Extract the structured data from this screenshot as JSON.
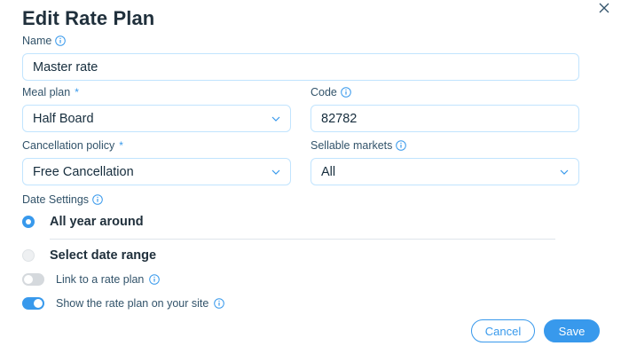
{
  "dialog": {
    "title": "Edit Rate Plan"
  },
  "name": {
    "label": "Name",
    "value": "Master rate"
  },
  "meal_plan": {
    "label": "Meal plan",
    "required_mark": "*",
    "value": "Half Board"
  },
  "code": {
    "label": "Code",
    "value": "82782"
  },
  "cancellation_policy": {
    "label": "Cancellation policy",
    "required_mark": "*",
    "value": "Free Cancellation"
  },
  "sellable_markets": {
    "label": "Sellable markets",
    "value": "All"
  },
  "date_settings": {
    "label": "Date Settings",
    "options": [
      {
        "label": "All year around",
        "selected": true
      },
      {
        "label": "Select date range",
        "selected": false
      }
    ]
  },
  "toggles": {
    "link_rate_plan": {
      "label": "Link to a rate plan",
      "on": false
    },
    "show_on_site": {
      "label": "Show the rate plan on your site",
      "on": true
    }
  },
  "buttons": {
    "cancel": "Cancel",
    "save": "Save"
  },
  "colors": {
    "accent": "#3899ec",
    "field_border": "#c1e4fe",
    "title": "#20303c"
  }
}
